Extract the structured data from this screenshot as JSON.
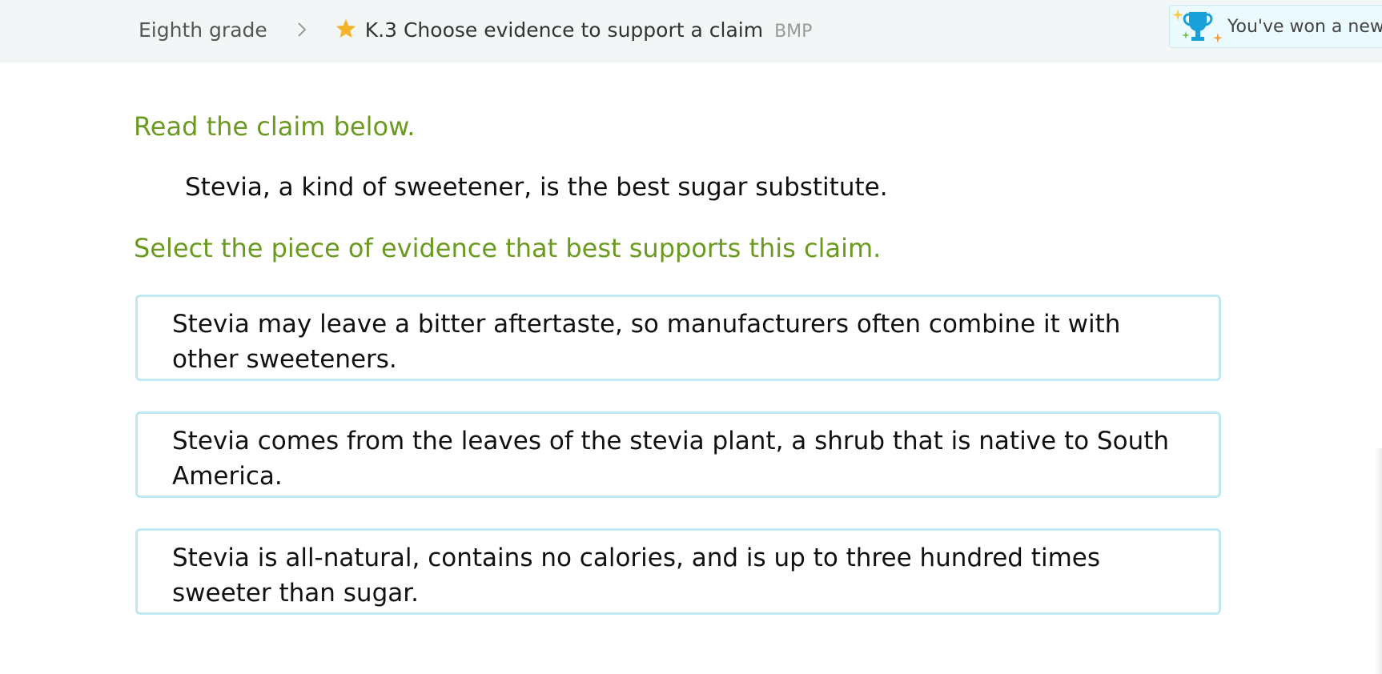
{
  "breadcrumb": {
    "grade": "Eighth grade",
    "separator_icon": "chevron-right-icon",
    "star_icon": "star-icon",
    "skill_title": "K.3 Choose evidence to support a claim",
    "skill_code": "BMP"
  },
  "award": {
    "icon": "trophy-icon",
    "text": "You've won a new award!"
  },
  "question": {
    "instruction_1": "Read the claim below.",
    "claim": "Stevia, a kind of sweetener, is the best sugar substitute.",
    "instruction_2": "Select the piece of evidence that best supports this claim.",
    "choices": [
      {
        "text": "Stevia may leave a bitter aftertaste, so manufacturers often combine it with other sweeteners."
      },
      {
        "text": "Stevia comes from the leaves of the stevia plant, a shrub that is native to South America."
      },
      {
        "text": "Stevia is all-natural, contains no calories, and is up to three hundred times sweeter than sugar."
      }
    ]
  },
  "colors": {
    "instruction": "#6a9a20",
    "choice_border": "#bfe8f0",
    "star": "#f5b52a",
    "trophy": "#1aa0d8",
    "topbar_bg": "#f3f6f7"
  }
}
